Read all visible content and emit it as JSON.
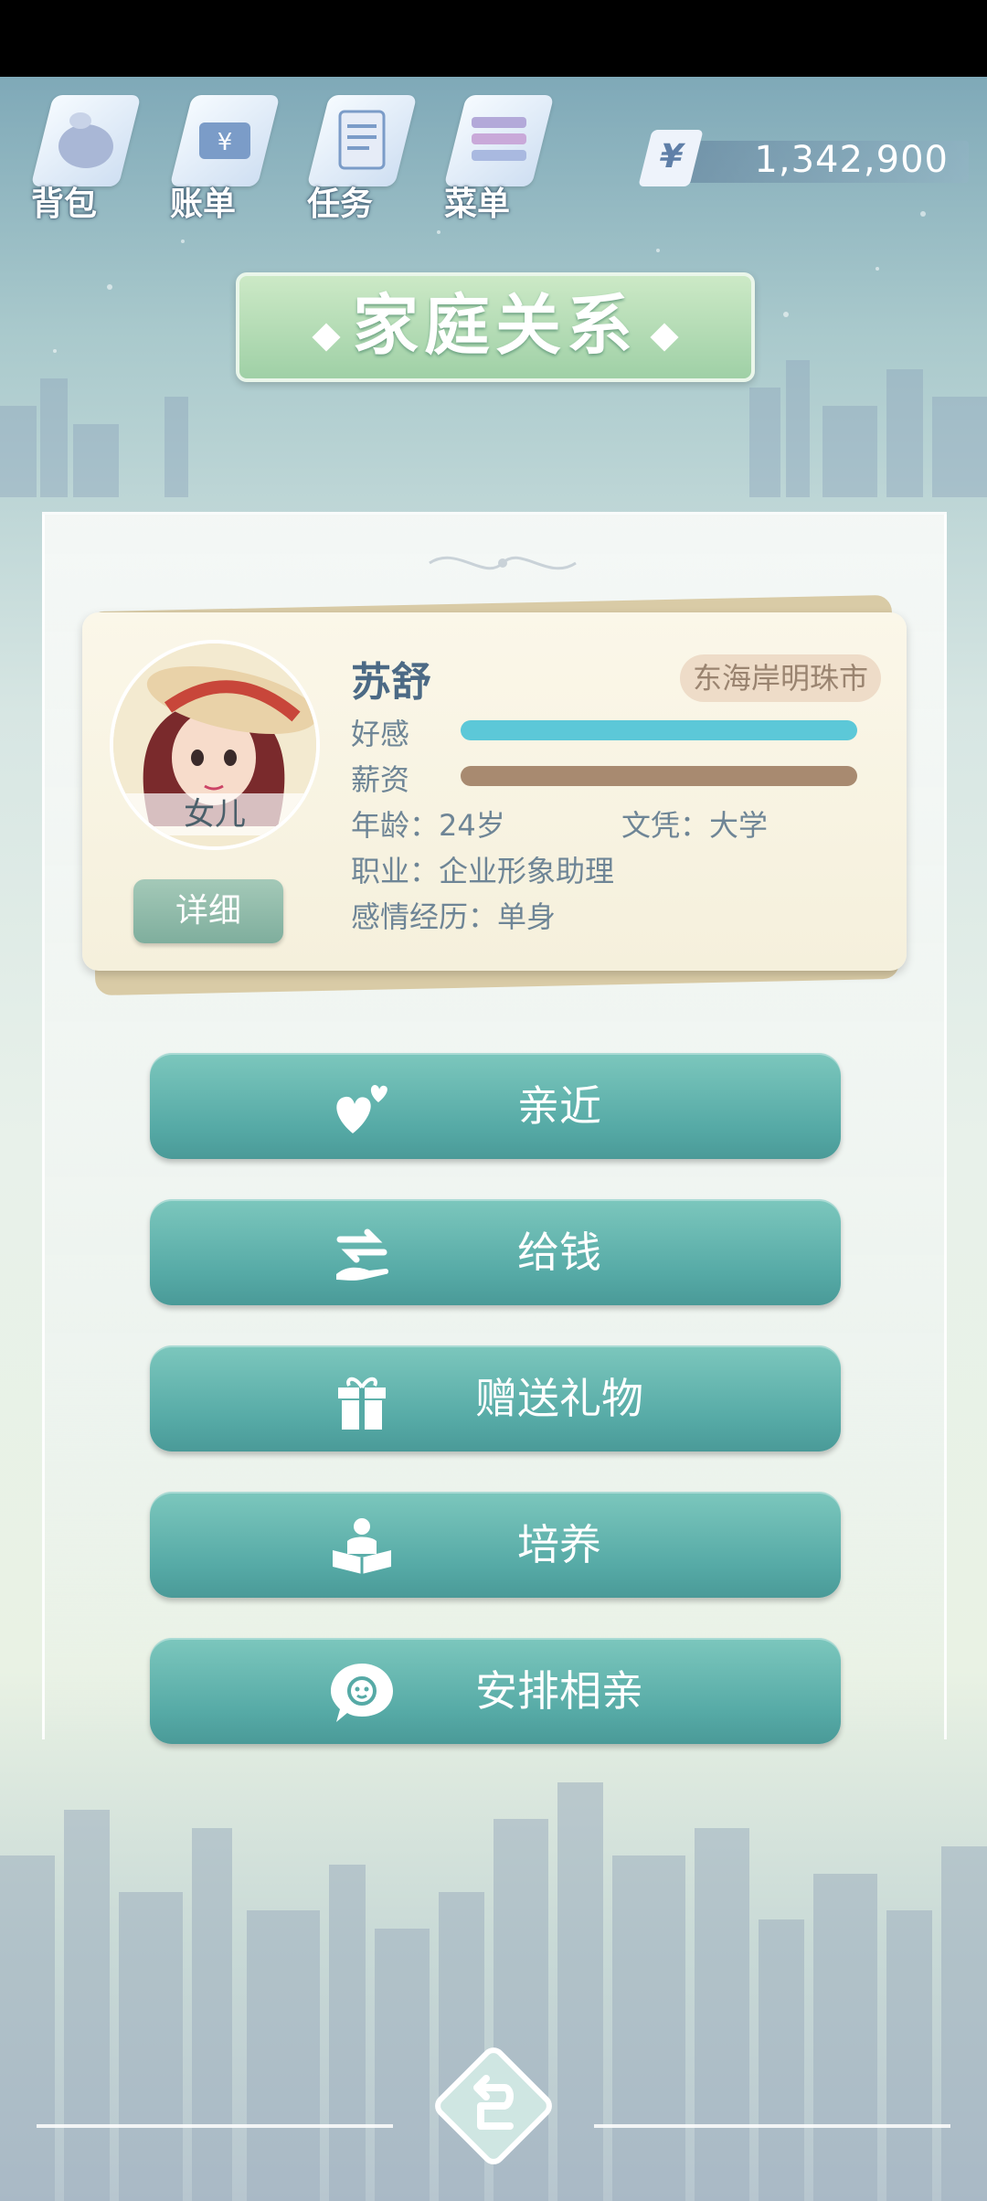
{
  "nav": {
    "bag": "背包",
    "bill": "账单",
    "task": "任务",
    "menu": "菜单"
  },
  "money": {
    "symbol": "¥",
    "value": "1,342,900"
  },
  "title": "家庭关系",
  "profile": {
    "name": "苏舒",
    "role": "女儿",
    "city": "东海岸明珠市",
    "favor_label": "好感",
    "salary_label": "薪资",
    "age": "年龄：24岁",
    "education": "文凭：大学",
    "job": "职业：企业形象助理",
    "relationship": "感情经历：单身",
    "detail_button": "详细"
  },
  "actions": [
    {
      "label": "亲近",
      "icon": "hearts-icon"
    },
    {
      "label": "给钱",
      "icon": "give-money-icon"
    },
    {
      "label": "赠送礼物",
      "icon": "gift-icon"
    },
    {
      "label": "培养",
      "icon": "reading-person-icon"
    },
    {
      "label": "安排相亲",
      "icon": "matchmaking-bubble-icon"
    }
  ],
  "colors": {
    "accent_teal": "#56aaa6",
    "title_green": "#9fd0a6",
    "favor_bar": "#5cc8d8",
    "salary_bar": "#a88a70"
  }
}
